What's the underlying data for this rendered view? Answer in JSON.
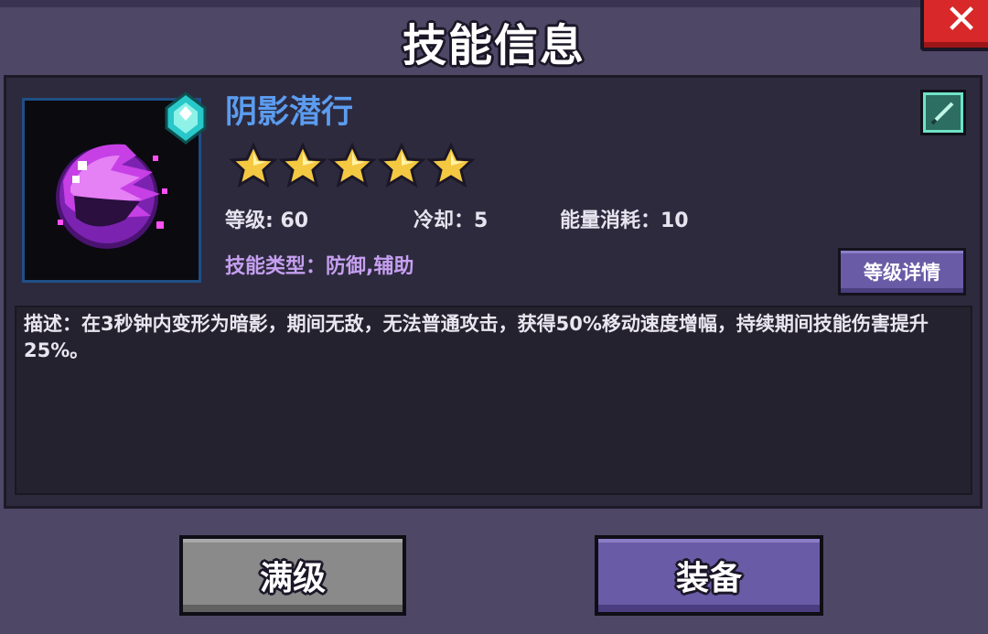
{
  "header": {
    "title": "技能信息"
  },
  "close_button": {
    "label": "✕"
  },
  "skill": {
    "name": "阴影潜行",
    "stars": 5,
    "stats": {
      "level": "等级: 60",
      "cooldown": "冷却：5",
      "energy_cost": "能量消耗：10"
    },
    "type": "技能类型：防御,辅助",
    "description": "描述：在3秒钟内变形为暗影，期间无敌，无法普通攻击，获得50%移动速度增幅，持续期间技能伤害提升25%。"
  },
  "buttons": {
    "level_detail": "等级详情",
    "max_level": "满级",
    "equip": "装备"
  },
  "icons": {
    "skill_icon": "shadow-orb-icon",
    "gem": "cyan-gem-icon",
    "edit": "sword-edit-icon",
    "star": "star-icon"
  },
  "colors": {
    "skill_name": "#5b9cf0",
    "skill_type": "#c59ff0",
    "star": "#f5c842",
    "close": "#d8282a",
    "primary_button": "#6a5ba6",
    "secondary_button": "#8a8a8a"
  }
}
